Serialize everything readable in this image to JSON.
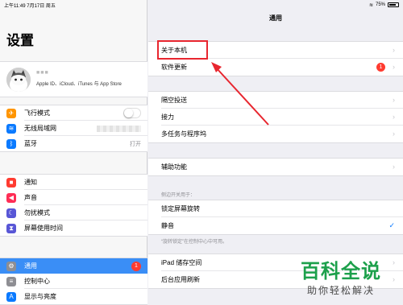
{
  "status": {
    "time": "上午11:49",
    "date": "7月17日 周五",
    "battery": "75%",
    "battery_level": 0.75
  },
  "sidebar": {
    "title": "设置",
    "profile": {
      "name": "■■■",
      "subtitle": "Apple ID、iCloud、iTunes 与 App Store"
    },
    "group1": [
      {
        "label": "飞行模式",
        "icon": "airplane-icon",
        "color": "#ff9500",
        "glyph": "✈"
      },
      {
        "label": "无线局域网",
        "icon": "wifi-icon",
        "color": "#0a7aff",
        "glyph": "≋"
      },
      {
        "label": "蓝牙",
        "icon": "bluetooth-icon",
        "color": "#0a7aff",
        "glyph": "ᛒ",
        "value": "打开"
      }
    ],
    "group2": [
      {
        "label": "通知",
        "icon": "notifications-icon",
        "color": "#ff3b30",
        "glyph": "■"
      },
      {
        "label": "声音",
        "icon": "sound-icon",
        "color": "#ff2d55",
        "glyph": "◀"
      },
      {
        "label": "勿扰模式",
        "icon": "moon-icon",
        "color": "#5856d6",
        "glyph": "☾"
      },
      {
        "label": "屏幕使用时间",
        "icon": "hourglass-icon",
        "color": "#5856d6",
        "glyph": "⧗"
      }
    ],
    "group3": [
      {
        "label": "通用",
        "icon": "gear-icon",
        "color": "#8e8e93",
        "glyph": "⚙",
        "badge": "1"
      },
      {
        "label": "控制中心",
        "icon": "control-center-icon",
        "color": "#8e8e93",
        "glyph": "≡"
      },
      {
        "label": "显示与亮度",
        "icon": "display-icon",
        "color": "#0a7aff",
        "glyph": "A"
      }
    ]
  },
  "main": {
    "title": "通用",
    "group1": [
      {
        "label": "关于本机"
      },
      {
        "label": "软件更新",
        "badge": "1"
      }
    ],
    "group2": [
      {
        "label": "隔空投送"
      },
      {
        "label": "接力"
      },
      {
        "label": "多任务与程序坞"
      }
    ],
    "group3": [
      {
        "label": "辅助功能"
      }
    ],
    "section_header": "侧边开关用于：",
    "group4": [
      {
        "label": "锁定屏幕旋转"
      },
      {
        "label": "静音"
      }
    ],
    "footnote": "“旋转锁定”在控制中心中可用。",
    "group5": [
      {
        "label": "iPad 储存空间"
      },
      {
        "label": "后台应用刷新"
      }
    ]
  },
  "watermark": {
    "main": "百科全说",
    "sub": "助你轻松解决"
  },
  "colors": {
    "accent": "#3a8ef6",
    "highlight": "#e8262f",
    "watermark": "#1ca04b"
  }
}
